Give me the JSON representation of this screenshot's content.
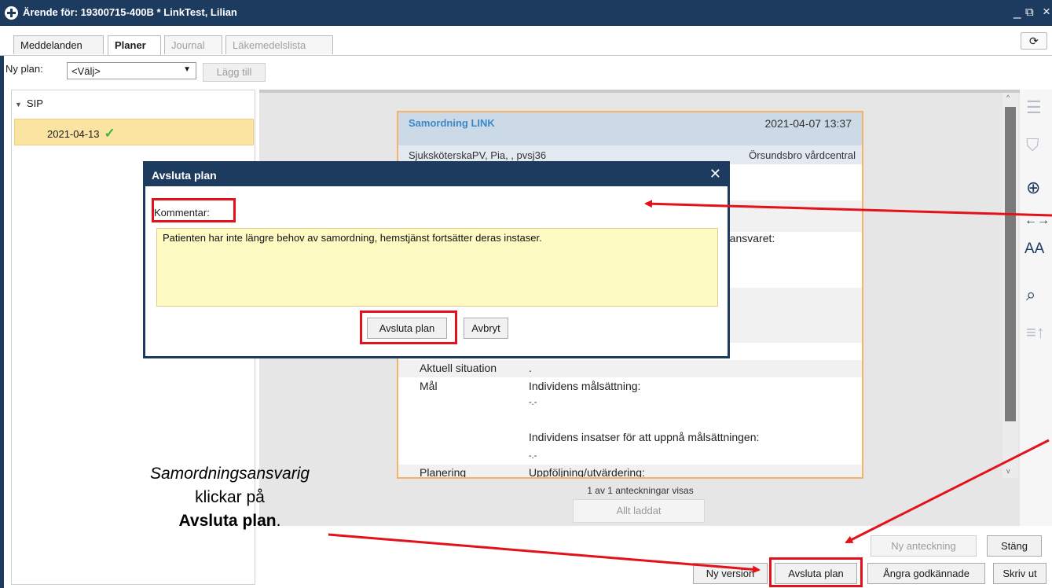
{
  "window": {
    "title": "Ärende för: 19300715-400B * LinkTest, Lilian",
    "min_glyph": "_",
    "restore_glyph": "⧉",
    "close_glyph": "×"
  },
  "tabs": [
    {
      "label": "Meddelanden",
      "state": "normal"
    },
    {
      "label": "Planer",
      "state": "active"
    },
    {
      "label": "Journal",
      "state": "disabled"
    },
    {
      "label": "Läkemedelslista",
      "state": "disabled"
    }
  ],
  "toolbar": {
    "ny_plan_label": "Ny plan:",
    "select_value": "<Välj>",
    "add_label": "Lägg till"
  },
  "tree": {
    "group_label": "SIP",
    "selected_item": "2021-04-13"
  },
  "note": {
    "title": "Samordning LINK",
    "datetime": "2021-04-07 13:37",
    "author": "SjuksköterskaPV, Pia, , pvsj36",
    "unit": "Örsundsbro vårdcentral",
    "partial_text": "e ansvaret:",
    "rows": {
      "aktuell_label": "Aktuell situation",
      "aktuell_value": ".",
      "mal_label": "Mål",
      "mal_line1": "Individens målsättning:",
      "mal_line2": "-.-",
      "mal_line3": "Individens insatser för att uppnå målsättningen:",
      "mal_line4": "-.-",
      "planering_label": "Planering",
      "planering_value": "Uppföljning/utvärdering:"
    }
  },
  "footer": {
    "notes_count": "1 av 1 anteckningar visas",
    "loaded_label": "Allt laddat"
  },
  "buttons": {
    "ny_anteckning": "Ny anteckning",
    "stang": "Stäng",
    "ny_version": "Ny version",
    "avsluta_plan": "Avsluta plan",
    "angra": "Ångra godkännade",
    "skriv_ut": "Skriv ut"
  },
  "dialog": {
    "title": "Avsluta plan",
    "close_glyph": "✕",
    "comment_label": "Kommentar:",
    "comment_value": "Patienten har inte längre behov av samordning, hemstjänst fortsätter deras instaser.",
    "confirm_label": "Avsluta plan",
    "cancel_label": "Avbryt"
  },
  "annotation": {
    "line1": "Samordningsansvarig",
    "line2": "klickar på",
    "line3_bold": "Avsluta plan",
    "line3_tail": "."
  },
  "colors": {
    "titlebar": "#1d3a5f",
    "highlight_red": "#e3121a",
    "selected_row": "#fbe3a1",
    "comment_bg": "#fefbc2",
    "note_border": "#f3b36a"
  },
  "icons": [
    "app-logo-icon",
    "history-icon",
    "chevron-down-icon",
    "expand-triangle-icon",
    "checkmark-icon",
    "list-icon",
    "filter-icon",
    "expand-collapse-icon",
    "width-arrows-icon",
    "font-size-icon",
    "document-search-icon",
    "sort-up-icon",
    "close-icon"
  ]
}
